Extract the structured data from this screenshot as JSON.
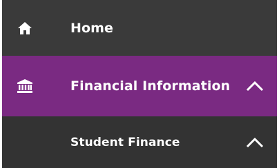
{
  "nav": {
    "items": [
      {
        "label": "Home",
        "icon": "home-icon"
      },
      {
        "label": "Financial Information",
        "icon": "bank-icon",
        "expanded": true
      },
      {
        "label": "Student Finance",
        "icon": "",
        "expanded": true
      }
    ]
  },
  "colors": {
    "home_bg": "#3a3a3a",
    "active_bg": "#7a2a82",
    "sub_bg": "#333333",
    "text": "#ffffff"
  }
}
